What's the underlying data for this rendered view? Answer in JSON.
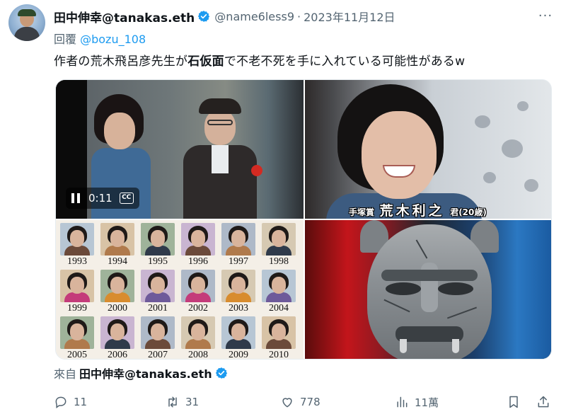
{
  "tweet": {
    "display_name": "田中伸幸@tanakas.eth",
    "handle": "@name6less9",
    "separator": "·",
    "date": "2023年11月12日",
    "more_label": "···",
    "reply_prefix": "回覆",
    "reply_to": "@bozu_108",
    "text_before": "作者の荒木飛呂彦先生が",
    "text_bold": "石仮面",
    "text_after": "で不老不死を手に入れている可能性があるw"
  },
  "media": {
    "video": {
      "time": "0:11",
      "cc_label": "CC"
    },
    "smile_caption": {
      "prefix": "手塚賞",
      "name": "荒木利之",
      "suffix": "君(20歳)"
    },
    "year_grid": [
      "1993",
      "1994",
      "1995",
      "1996",
      "1997",
      "1998",
      "1999",
      "2000",
      "2001",
      "2002",
      "2003",
      "2004",
      "2005",
      "2006",
      "2007",
      "2008",
      "2009",
      "2010"
    ]
  },
  "source": {
    "prefix": "來自",
    "name": "田中伸幸@tanakas.eth"
  },
  "actions": {
    "replies": "11",
    "retweets": "31",
    "likes": "778",
    "views": "11萬"
  },
  "colors": {
    "text_primary": "#0f1419",
    "text_secondary": "#536471",
    "link_blue": "#1d9bf0",
    "verified_blue": "#1d9bf0"
  }
}
